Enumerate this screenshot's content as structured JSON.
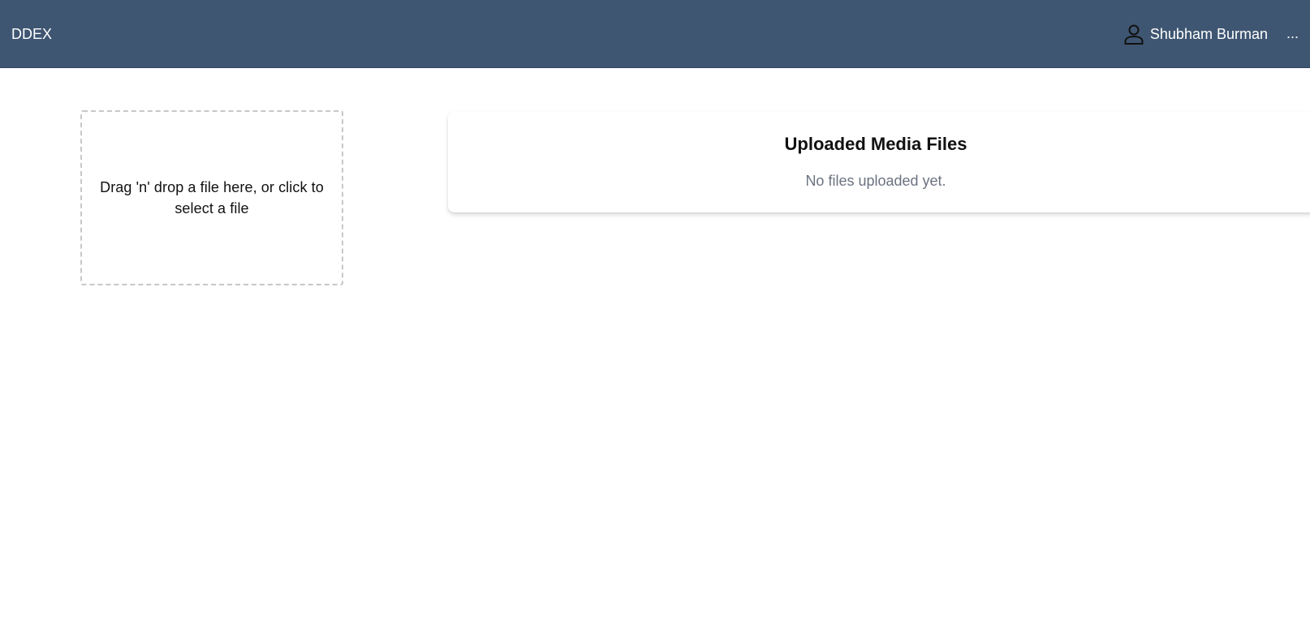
{
  "navbar": {
    "brand": "DDEX",
    "user_icon": "user-icon",
    "user_name": "Shubham Burman",
    "more_label": "..."
  },
  "upload": {
    "dropzone_text": "Drag 'n' drop a file here, or click to select a file"
  },
  "files_panel": {
    "title": "Uploaded Media Files",
    "empty_message": "No files uploaded yet."
  },
  "colors": {
    "navbar_bg": "#3f5672",
    "navbar_text": "#ffffff",
    "muted_text": "#6b7280",
    "dropzone_border": "#c8c8c8"
  }
}
